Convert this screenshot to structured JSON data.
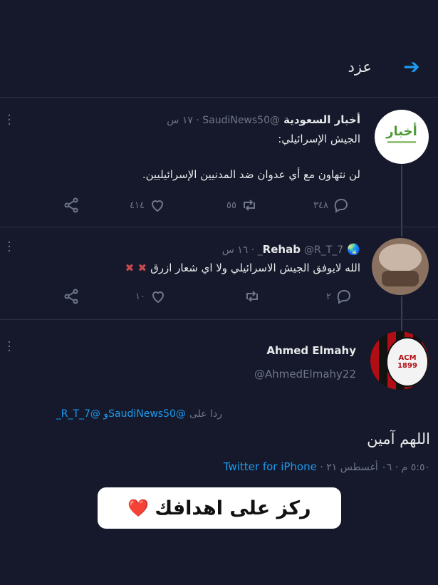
{
  "header": {
    "title": "عزد"
  },
  "tweets": [
    {
      "name": "أخبار السعودية",
      "handle_time": "@SaudiNews50 · ١٧ س",
      "line1": "الجيش الإسرائيلي:",
      "line2": "لن نتهاون مع أي عدوان ضد المدنيين الإسرائيليين.",
      "avatar_text": "أخبار",
      "replies": "٣٤٨",
      "retweets": "٥٥",
      "likes": "٤١٤"
    },
    {
      "name": "Rehab",
      "handle_time": "@R_T_7_ · ١٦ س",
      "text": "الله لايوفق الجيش الاسرائيلي ولا اي شعار ازرق",
      "x_tags": "✖ ✖",
      "replies": "٢",
      "retweets": "",
      "likes": "١٠"
    }
  ],
  "focused": {
    "name": "Ahmed Elmahy",
    "handle": "@AhmedElmahy22",
    "reply_to_prefix": "ردا على",
    "reply_to_handles": "@SaudiNews50و @R_T_7_",
    "text": "اللهم آمين",
    "time": "٥:٥٠ م · ٠٦ أغسطس ٢١ · ",
    "source": "Twitter for iPhone",
    "crest_text": "ACM 1899"
  },
  "caption": {
    "text": "ركز على اهدافك",
    "emoji": "❤️"
  },
  "colors": {
    "background": "#15192b",
    "accent": "#1d9bf0",
    "muted": "#6f7787"
  }
}
